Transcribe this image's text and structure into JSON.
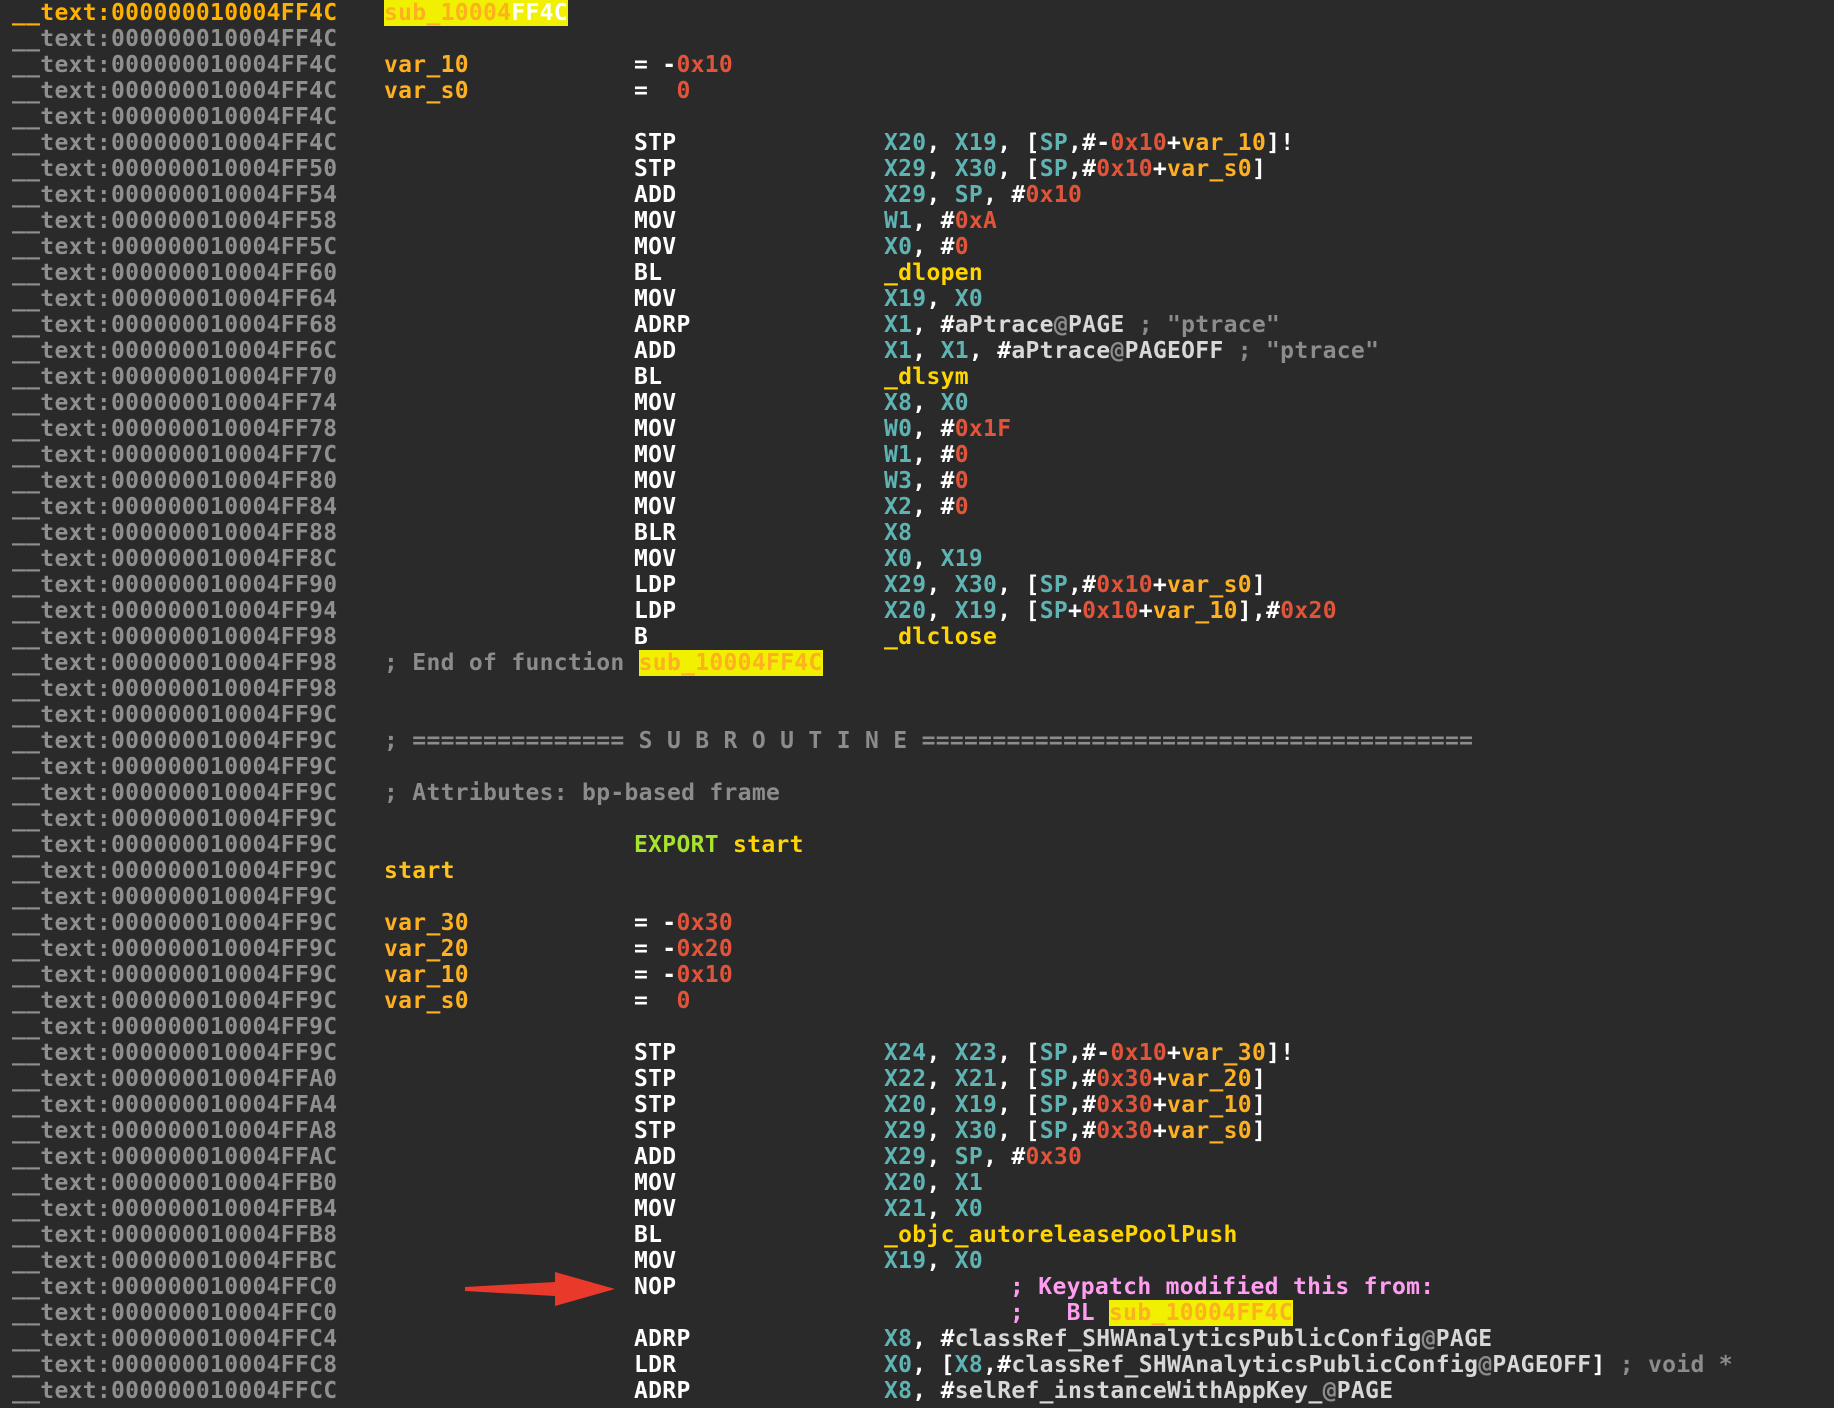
{
  "segment": "__text",
  "rows": [
    {
      "addr": "__text:000000010004FF4C",
      "current": true,
      "label_pre": "sub_10004",
      "label_hl": "FF4C"
    },
    {
      "addr": "__text:000000010004FF4C"
    },
    {
      "addr": "__text:000000010004FF4C",
      "var": "var_10",
      "assign": "= -0x10"
    },
    {
      "addr": "__text:000000010004FF4C",
      "var": "var_s0",
      "assign": "=  0"
    },
    {
      "addr": "__text:000000010004FF4C"
    },
    {
      "addr": "__text:000000010004FF4C",
      "mn": "STP",
      "ops": "X20, X19, [SP,#-0x10+var_10]!"
    },
    {
      "addr": "__text:000000010004FF50",
      "mn": "STP",
      "ops": "X29, X30, [SP,#0x10+var_s0]"
    },
    {
      "addr": "__text:000000010004FF54",
      "mn": "ADD",
      "ops": "X29, SP, #0x10"
    },
    {
      "addr": "__text:000000010004FF58",
      "mn": "MOV",
      "ops": "W1, #0xA"
    },
    {
      "addr": "__text:000000010004FF5C",
      "mn": "MOV",
      "ops": "X0, #0"
    },
    {
      "addr": "__text:000000010004FF60",
      "mn": "BL",
      "ops": "_dlopen"
    },
    {
      "addr": "__text:000000010004FF64",
      "mn": "MOV",
      "ops": "X19, X0"
    },
    {
      "addr": "__text:000000010004FF68",
      "mn": "ADRP",
      "ops": "X1, #aPtrace@PAGE",
      "cmt": "; \"ptrace\""
    },
    {
      "addr": "__text:000000010004FF6C",
      "mn": "ADD",
      "ops": "X1, X1, #aPtrace@PAGEOFF",
      "cmt": "; \"ptrace\""
    },
    {
      "addr": "__text:000000010004FF70",
      "mn": "BL",
      "ops": "_dlsym"
    },
    {
      "addr": "__text:000000010004FF74",
      "mn": "MOV",
      "ops": "X8, X0"
    },
    {
      "addr": "__text:000000010004FF78",
      "mn": "MOV",
      "ops": "W0, #0x1F"
    },
    {
      "addr": "__text:000000010004FF7C",
      "mn": "MOV",
      "ops": "W1, #0"
    },
    {
      "addr": "__text:000000010004FF80",
      "mn": "MOV",
      "ops": "W3, #0"
    },
    {
      "addr": "__text:000000010004FF84",
      "mn": "MOV",
      "ops": "X2, #0"
    },
    {
      "addr": "__text:000000010004FF88",
      "mn": "BLR",
      "ops": "X8"
    },
    {
      "addr": "__text:000000010004FF8C",
      "mn": "MOV",
      "ops": "X0, X19"
    },
    {
      "addr": "__text:000000010004FF90",
      "mn": "LDP",
      "ops": "X29, X30, [SP,#0x10+var_s0]"
    },
    {
      "addr": "__text:000000010004FF94",
      "mn": "LDP",
      "ops": "X20, X19, [SP+0x10+var_10],#0x20"
    },
    {
      "addr": "__text:000000010004FF98",
      "mn": "B",
      "ops": "_dlclose"
    },
    {
      "addr": "__text:000000010004FF98",
      "comment0": "; End of function ",
      "comment0_hl": "sub_10004FF4C"
    },
    {
      "addr": "__text:000000010004FF98"
    },
    {
      "addr": "__text:000000010004FF9C"
    },
    {
      "addr": "__text:000000010004FF9C",
      "comment0": "; =============== S U B R O U T I N E ======================================="
    },
    {
      "addr": "__text:000000010004FF9C"
    },
    {
      "addr": "__text:000000010004FF9C",
      "comment0": "; Attributes: bp-based frame"
    },
    {
      "addr": "__text:000000010004FF9C"
    },
    {
      "addr": "__text:000000010004FF9C",
      "export_kw": "EXPORT",
      "export_name": " start"
    },
    {
      "addr": "__text:000000010004FF9C",
      "label": "start"
    },
    {
      "addr": "__text:000000010004FF9C"
    },
    {
      "addr": "__text:000000010004FF9C",
      "var": "var_30",
      "assign": "= -0x30"
    },
    {
      "addr": "__text:000000010004FF9C",
      "var": "var_20",
      "assign": "= -0x20"
    },
    {
      "addr": "__text:000000010004FF9C",
      "var": "var_10",
      "assign": "= -0x10"
    },
    {
      "addr": "__text:000000010004FF9C",
      "var": "var_s0",
      "assign": "=  0"
    },
    {
      "addr": "__text:000000010004FF9C"
    },
    {
      "addr": "__text:000000010004FF9C",
      "mn": "STP",
      "ops": "X24, X23, [SP,#-0x10+var_30]!"
    },
    {
      "addr": "__text:000000010004FFA0",
      "mn": "STP",
      "ops": "X22, X21, [SP,#0x30+var_20]"
    },
    {
      "addr": "__text:000000010004FFA4",
      "mn": "STP",
      "ops": "X20, X19, [SP,#0x30+var_10]"
    },
    {
      "addr": "__text:000000010004FFA8",
      "mn": "STP",
      "ops": "X29, X30, [SP,#0x30+var_s0]"
    },
    {
      "addr": "__text:000000010004FFAC",
      "mn": "ADD",
      "ops": "X29, SP, #0x30"
    },
    {
      "addr": "__text:000000010004FFB0",
      "mn": "MOV",
      "ops": "X20, X1"
    },
    {
      "addr": "__text:000000010004FFB4",
      "mn": "MOV",
      "ops": "X21, X0"
    },
    {
      "addr": "__text:000000010004FFB8",
      "mn": "BL",
      "ops": "_objc_autoreleasePoolPush"
    },
    {
      "addr": "__text:000000010004FFBC",
      "mn": "MOV",
      "ops": "X19, X0"
    },
    {
      "addr": "__text:000000010004FFC0",
      "mn": "NOP",
      "cm2": "; Keypatch modified this from:"
    },
    {
      "addr": "__text:000000010004FFC0",
      "cm2": ";   BL ",
      "cm2_hl": "sub_10004FF4C"
    },
    {
      "addr": "__text:000000010004FFC4",
      "mn": "ADRP",
      "ops": "X8, #classRef_SHWAnalyticsPublicConfig@PAGE"
    },
    {
      "addr": "__text:000000010004FFC8",
      "mn": "LDR",
      "ops": "X0, [X8,#classRef_SHWAnalyticsPublicConfig@PAGEOFF]",
      "cmt": "; void *"
    },
    {
      "addr": "__text:000000010004FFCC",
      "mn": "ADRP",
      "ops": "X8, #selRef_instanceWithAppKey_@PAGE"
    }
  ],
  "colors": {
    "background": "#2a2a2a",
    "address": "#8f8f8f",
    "current_address": "#ffb000",
    "register": "#5fb3b3",
    "number": "#e2543a",
    "variable": "#ffb020",
    "symbol": "#ffd400",
    "highlight": "#f0f000",
    "keypatch_comment": "#ff9ef0",
    "arrow": "#e8392a"
  },
  "arrow_icon": "red-arrow-pointing-right"
}
